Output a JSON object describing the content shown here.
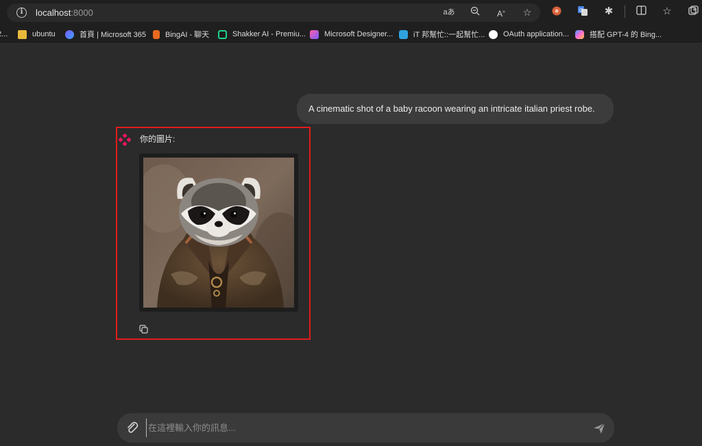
{
  "browser": {
    "url_host": "localhost",
    "url_port": ":8000",
    "address_icons": [
      "read-aloud-icon",
      "zoom-out-icon",
      "immersive-reader-icon",
      "favorite-star-icon"
    ],
    "extension_icons": [
      "extension-icon",
      "translate-icon",
      "puzzle-icon",
      "split-screen-icon",
      "favorites-icon",
      "collections-icon"
    ]
  },
  "bookmarks": [
    {
      "label": "2...",
      "icon": "truncated-bookmark-icon"
    },
    {
      "label": "ubuntu",
      "icon": "folder-icon",
      "color": "#e8b93b"
    },
    {
      "label": "首頁 | Microsoft 365",
      "icon": "microsoft365-icon",
      "color": "#7b5cff"
    },
    {
      "label": "BingAI - 聊天",
      "icon": "bing-icon",
      "color": "#e86a1e"
    },
    {
      "label": "Shakker AI - Premiu...",
      "icon": "shakker-icon",
      "color": "#1fd38a"
    },
    {
      "label": "Microsoft Designer...",
      "icon": "designer-icon",
      "color": "#c64cff"
    },
    {
      "label": "iT 邦幫忙::一起幫忙...",
      "icon": "ithome-icon",
      "color": "#2ea3e0"
    },
    {
      "label": "OAuth application...",
      "icon": "github-icon",
      "color": "#ffffff"
    },
    {
      "label": "搭配 GPT-4 的 Bing...",
      "icon": "copilot-icon",
      "color": "#3aa0ff"
    }
  ],
  "chat": {
    "user_message": "A cinematic shot of a baby racoon wearing an intricate italian priest robe.",
    "bot_label": "你的圖片:",
    "image_alt": "Raccoon wearing ornate brown robe"
  },
  "input": {
    "placeholder": "在這裡輸入你的訊息..."
  },
  "colors": {
    "highlight": "#e31b1b",
    "background": "#2b2b2b",
    "bubble": "#3c3c3c"
  }
}
